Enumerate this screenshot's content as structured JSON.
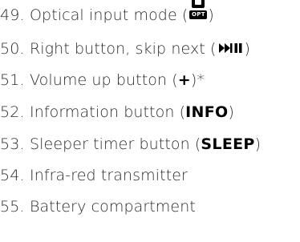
{
  "items": [
    {
      "num": "49.",
      "label": "Optical input mode (",
      "icon": "optical-input-icon",
      "icon_text": "OPT",
      "suffix": ")"
    },
    {
      "num": "50.",
      "label": "Right button, skip next (",
      "icon": "skip-next-play-pause-icon",
      "suffix": ")"
    },
    {
      "num": "51.",
      "label": "Volume up button (",
      "key": "+",
      "suffix": ")*"
    },
    {
      "num": "52.",
      "label": "Information button (",
      "key": "INFO",
      "suffix": ")"
    },
    {
      "num": "53.",
      "label": "Sleeper timer button (",
      "key": "SLEEP",
      "suffix": ")"
    },
    {
      "num": "54.",
      "label": "Infra-red transmitter"
    },
    {
      "num": "55.",
      "label": "Battery compartment"
    }
  ]
}
